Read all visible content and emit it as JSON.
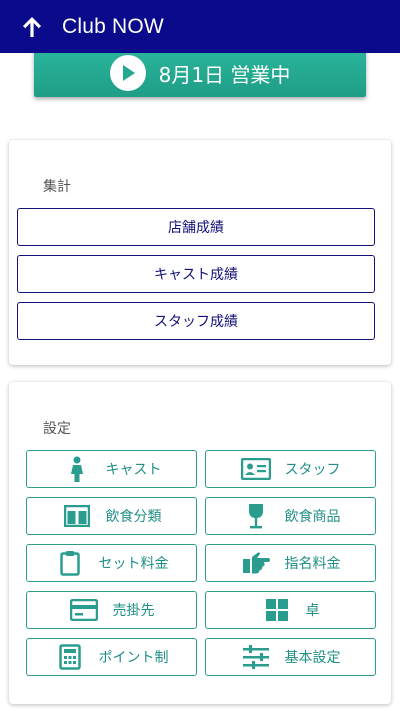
{
  "appbar": {
    "title": "Club NOW"
  },
  "status": {
    "label": "8月1日 営業中"
  },
  "summary": {
    "title": "集計",
    "buttons": [
      "店舗成績",
      "キャスト成績",
      "スタッフ成績"
    ]
  },
  "settings": {
    "title": "設定",
    "items": [
      {
        "label": "キャスト",
        "icon": "person-icon"
      },
      {
        "label": "スタッフ",
        "icon": "id-card-icon"
      },
      {
        "label": "飲食分類",
        "icon": "book-icon"
      },
      {
        "label": "飲食商品",
        "icon": "wine-glass-icon"
      },
      {
        "label": "セット料金",
        "icon": "clipboard-icon"
      },
      {
        "label": "指名料金",
        "icon": "pointing-hand-icon"
      },
      {
        "label": "売掛先",
        "icon": "credit-card-icon"
      },
      {
        "label": "卓",
        "icon": "grid-icon"
      },
      {
        "label": "ポイント制",
        "icon": "calculator-icon"
      },
      {
        "label": "基本設定",
        "icon": "sliders-icon"
      }
    ]
  },
  "colors": {
    "appbar": "#0a0a8a",
    "accent": "#2a9d8f",
    "navy": "#12127a"
  }
}
